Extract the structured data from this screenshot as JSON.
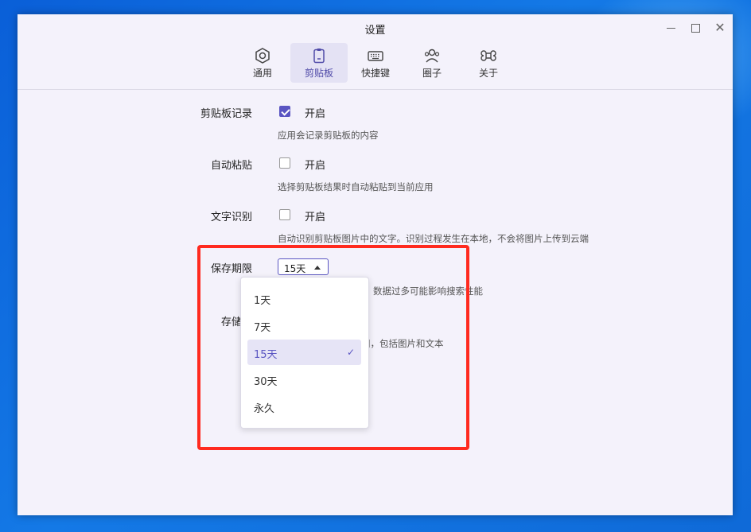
{
  "window": {
    "title": "设置"
  },
  "tabs": [
    {
      "label": "通用",
      "icon": "hexagon-gear-icon"
    },
    {
      "label": "剪贴板",
      "icon": "clipboard-icon",
      "active": true
    },
    {
      "label": "快捷键",
      "icon": "keyboard-icon"
    },
    {
      "label": "圈子",
      "icon": "people-icon"
    },
    {
      "label": "关于",
      "icon": "command-icon"
    }
  ],
  "settings": {
    "clipboard_history": {
      "label": "剪贴板记录",
      "option": "开启",
      "checked": true,
      "hint": "应用会记录剪贴板的内容"
    },
    "auto_paste": {
      "label": "自动粘贴",
      "option": "开启",
      "checked": false,
      "hint": "选择剪贴板结果时自动粘贴到当前应用"
    },
    "ocr": {
      "label": "文字识别",
      "option": "开启",
      "checked": false,
      "hint": "自动识别剪贴板图片中的文字。识别过程发生在本地，不会将图片上传到云端"
    },
    "retention": {
      "label": "保存期限",
      "value": "15天",
      "hint_partial": "数据过多可能影响搜索性能"
    },
    "storage": {
      "label_partial": "存储空",
      "hint_partial": "间，包括图片和文本"
    }
  },
  "dropdown": {
    "options": [
      "1天",
      "7天",
      "15天",
      "30天",
      "永久"
    ],
    "selected": "15天",
    "selected_icon": "check-icon"
  },
  "colors": {
    "accent": "#5a55c2",
    "highlight": "#ff2a1f"
  }
}
